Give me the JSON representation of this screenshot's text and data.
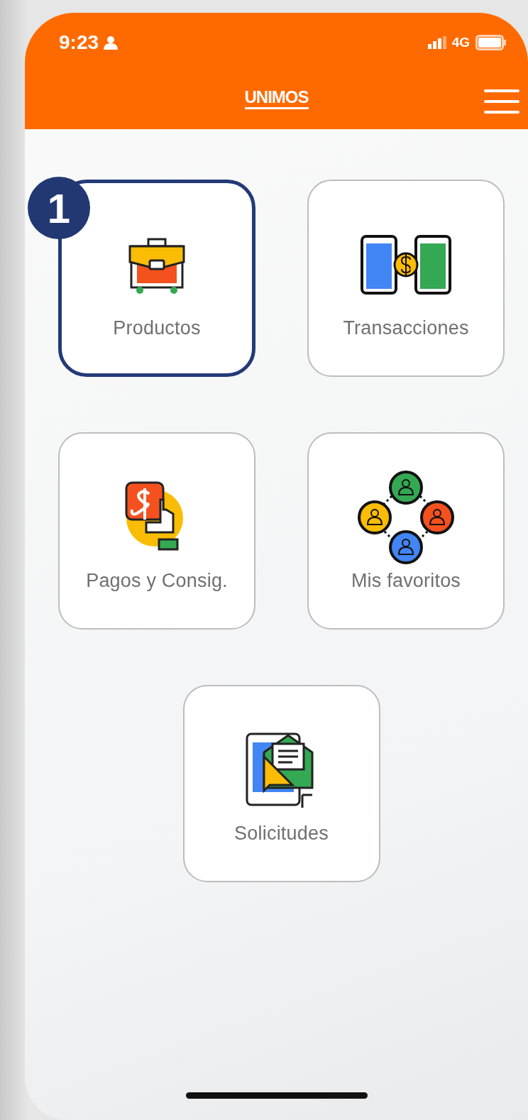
{
  "status_bar": {
    "time": "9:23",
    "network": "4G"
  },
  "header": {
    "logo": "UNIMOS"
  },
  "menu": [
    {
      "label": "Productos",
      "kind": "briefcase",
      "highlighted": true,
      "callout": "1"
    },
    {
      "label": "Transacciones",
      "kind": "transfer",
      "highlighted": false
    },
    {
      "label": "Pagos y Consig.",
      "kind": "payment",
      "highlighted": false
    },
    {
      "label": "Mis favoritos",
      "kind": "contacts",
      "highlighted": false
    },
    {
      "label": "Solicitudes",
      "kind": "requests",
      "highlighted": false
    }
  ]
}
